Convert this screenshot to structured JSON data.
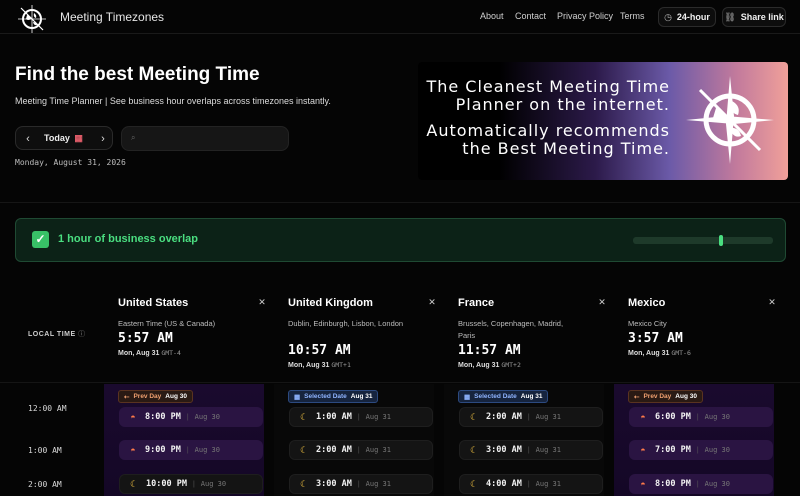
{
  "brand": {
    "name": "Meeting Timezones"
  },
  "nav": {
    "about": "About",
    "contact": "Contact",
    "privacy": "Privacy Policy",
    "terms": "Terms",
    "format_btn": "24-hour",
    "share_btn": "Share link"
  },
  "hero": {
    "title": "Find the best Meeting Time",
    "subtitle": "Meeting Time Planner | See business hour overlaps across timezones instantly.",
    "today_label": "Today",
    "current_date": "Monday, August 31, 2026",
    "search_placeholder": ""
  },
  "banner": {
    "line1": "The Cleanest Meeting Time Planner on the internet.",
    "line2": "Automatically recommends the Best Meeting Time."
  },
  "overlap": {
    "text": "1 hour of business overlap",
    "color": "#4ade80"
  },
  "grid": {
    "local_time_label": "LOCAL TIME",
    "rows": [
      "12:00 AM",
      "1:00 AM",
      "2:00 AM"
    ]
  },
  "zones": [
    {
      "country": "United States",
      "region": "Eastern Time (US & Canada)",
      "time": "5:57 AM",
      "date": "Mon, Aug 31",
      "gmt": "GMT-4",
      "tag_type": "prev",
      "tag_label": "Prev Day",
      "tag_date": "Aug 30",
      "slots": [
        {
          "icon": "sunset",
          "time": "8:00 PM",
          "date": "Aug 30"
        },
        {
          "icon": "sunset",
          "time": "9:00 PM",
          "date": "Aug 30"
        },
        {
          "icon": "moon",
          "time": "10:00 PM",
          "date": "Aug 30"
        }
      ]
    },
    {
      "country": "United Kingdom",
      "region": "Dublin, Edinburgh, Lisbon, London",
      "time": "10:57 AM",
      "date": "Mon, Aug 31",
      "gmt": "GMT+1",
      "tag_type": "selected",
      "tag_label": "Selected Date",
      "tag_date": "Aug 31",
      "slots": [
        {
          "icon": "moon",
          "time": "1:00 AM",
          "date": "Aug 31"
        },
        {
          "icon": "moon",
          "time": "2:00 AM",
          "date": "Aug 31"
        },
        {
          "icon": "moon",
          "time": "3:00 AM",
          "date": "Aug 31"
        }
      ]
    },
    {
      "country": "France",
      "region": "Brussels, Copenhagen, Madrid, Paris",
      "time": "11:57 AM",
      "date": "Mon, Aug 31",
      "gmt": "GMT+2",
      "tag_type": "selected",
      "tag_label": "Selected Date",
      "tag_date": "Aug 31",
      "slots": [
        {
          "icon": "moon",
          "time": "2:00 AM",
          "date": "Aug 31"
        },
        {
          "icon": "moon",
          "time": "3:00 AM",
          "date": "Aug 31"
        },
        {
          "icon": "moon",
          "time": "4:00 AM",
          "date": "Aug 31"
        }
      ]
    },
    {
      "country": "Mexico",
      "region": "Mexico City",
      "time": "3:57 AM",
      "date": "Mon, Aug 31",
      "gmt": "GMT-6",
      "tag_type": "prev",
      "tag_label": "Prev Day",
      "tag_date": "Aug 30",
      "slots": [
        {
          "icon": "sunset",
          "time": "6:00 PM",
          "date": "Aug 30"
        },
        {
          "icon": "sunset",
          "time": "7:00 PM",
          "date": "Aug 30"
        },
        {
          "icon": "sunset",
          "time": "8:00 PM",
          "date": "Aug 30"
        }
      ]
    }
  ]
}
